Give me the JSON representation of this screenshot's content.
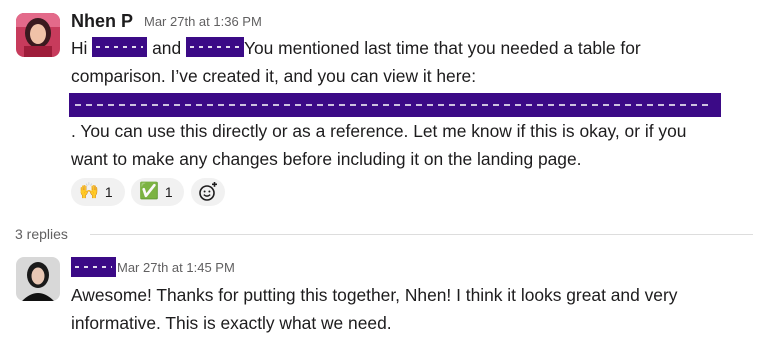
{
  "message1": {
    "sender": "Nhen P",
    "timestamp": "Mar 27th at 1:36 PM",
    "line1_a": "Hi",
    "line1_b": "and",
    "line1_c": "You mentioned last time that you needed a table for",
    "line2": "comparison. I’ve created it, and you can view it here:",
    "line4": ". You can use this directly or as a reference. Let me know if this is okay, or if you",
    "line5": "want to make any changes before including it on the landing page.",
    "reactions": [
      {
        "emoji": "🙌",
        "icon": "raised-hands-icon",
        "count": "1"
      },
      {
        "emoji": "✅",
        "icon": "check-mark-icon",
        "count": "1"
      }
    ]
  },
  "thread": {
    "replies_label": "3 replies"
  },
  "message2": {
    "timestamp": "Mar 27th at 1:45 PM",
    "line1": "Awesome! Thanks for putting this together, Nhen! I think it looks great and very",
    "line2": "informative. This is exactly what we need."
  },
  "colors": {
    "redaction": "#3b0a86",
    "reaction_bg": "#f1f1f1",
    "timestamp": "#616061"
  }
}
